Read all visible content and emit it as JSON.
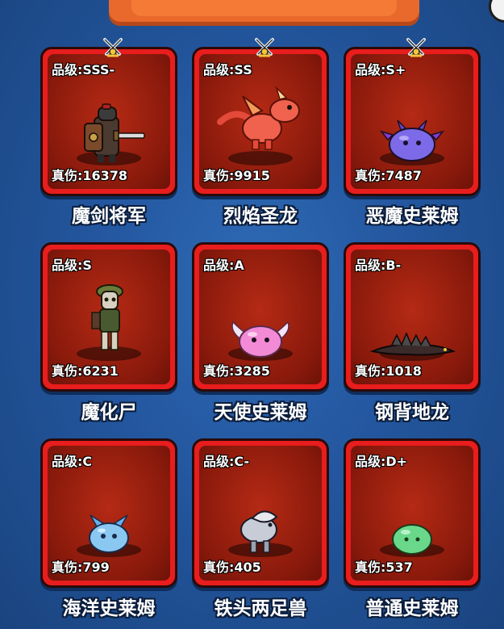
{
  "monsters": [
    {
      "grade": "品级:SSS-",
      "damage": "真伤:16378",
      "name": "魔剑将军",
      "equipped": true,
      "creature": "sword-general"
    },
    {
      "grade": "品级:SS",
      "damage": "真伤:9915",
      "name": "烈焰圣龙",
      "equipped": true,
      "creature": "flame-dragon"
    },
    {
      "grade": "品级:S+",
      "damage": "真伤:7487",
      "name": "恶魔史莱姆",
      "equipped": true,
      "creature": "demon-slime"
    },
    {
      "grade": "品级:S",
      "damage": "真伤:6231",
      "name": "魔化尸",
      "equipped": false,
      "creature": "zombie"
    },
    {
      "grade": "品级:A",
      "damage": "真伤:3285",
      "name": "天使史莱姆",
      "equipped": false,
      "creature": "angel-slime"
    },
    {
      "grade": "品级:B-",
      "damage": "真伤:1018",
      "name": "钢背地龙",
      "equipped": false,
      "creature": "steel-back-lizard"
    },
    {
      "grade": "品级:C",
      "damage": "真伤:799",
      "name": "海洋史莱姆",
      "equipped": false,
      "creature": "ocean-slime"
    },
    {
      "grade": "品级:C-",
      "damage": "真伤:405",
      "name": "铁头两足兽",
      "equipped": false,
      "creature": "iron-head-biped"
    },
    {
      "grade": "品级:D+",
      "damage": "真伤:537",
      "name": "普通史莱姆",
      "equipped": false,
      "creature": "common-slime"
    }
  ],
  "colors": {
    "background": "#23569e",
    "card_frame": "#e81d1d",
    "card_bg": "#8a1a0c",
    "banner": "#f47a35"
  }
}
